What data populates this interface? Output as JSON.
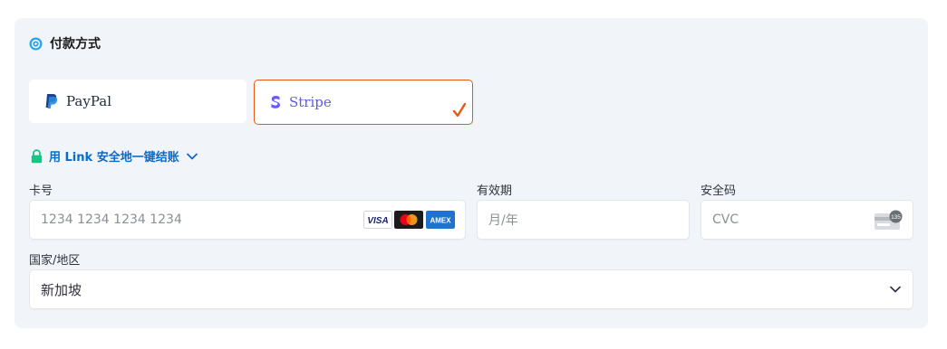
{
  "payment": {
    "section_title": "付款方式",
    "methods": [
      {
        "label": "PayPal",
        "icon": "paypal-icon"
      },
      {
        "label": "Stripe",
        "icon": "stripe-icon",
        "selected": true
      }
    ],
    "link_text": "用 Link 安全地一键结账",
    "card_number": {
      "label": "卡号",
      "placeholder": "1234 1234 1234 1234",
      "brands": [
        "VISA",
        "mastercard",
        "AMEX"
      ]
    },
    "expiry": {
      "label": "有效期",
      "placeholder": "月/年"
    },
    "cvc": {
      "label": "安全码",
      "placeholder": "CVC",
      "badge": "135"
    },
    "country": {
      "label": "国家/地区",
      "value": "新加坡"
    }
  },
  "colors": {
    "panel_bg": "#f1f4f8",
    "accent_orange": "#e8590c",
    "link_blue": "#0b6bcb",
    "stripe_purple": "#635bff",
    "lock_green": "#16c784"
  }
}
